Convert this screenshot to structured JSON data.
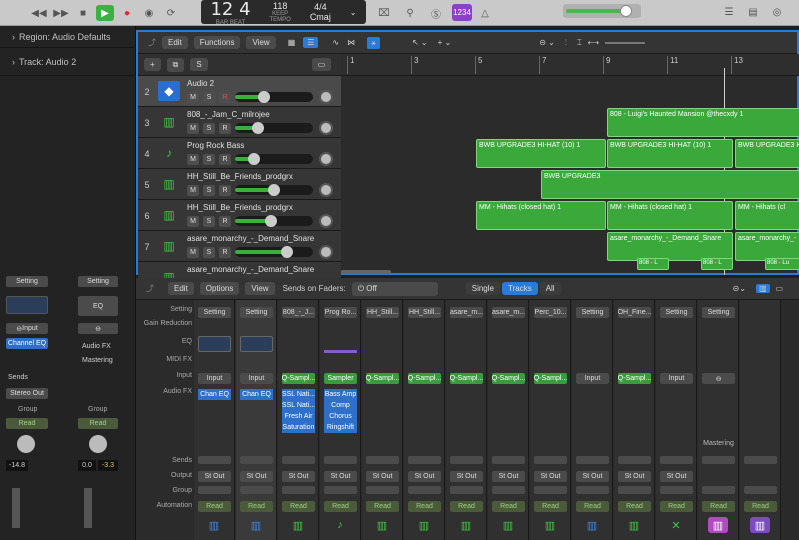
{
  "control": {
    "bar": "12",
    "beat": "4",
    "bar_lbl": "BAR",
    "beat_lbl": "BEAT",
    "tempo": "118",
    "keep": "KEEP",
    "tempo_lbl": "TEMPO",
    "sig": "4/4",
    "key": "Cmaj",
    "count_in": "1234"
  },
  "inspector": {
    "region": "Region: Audio Defaults",
    "track": "Track: Audio 2",
    "ch1": {
      "setting": "Setting",
      "input": "Input",
      "eq": "Channel EQ",
      "sends": "Sends",
      "out": "Stereo Out",
      "group": "Group",
      "read": "Read",
      "vol": "-14.8"
    },
    "ch2": {
      "setting": "Setting",
      "eq": "EQ",
      "afx": "Audio FX",
      "mast": "Mastering",
      "group": "Group",
      "read": "Read",
      "v1": "0.0",
      "v2": "-3.3"
    }
  },
  "tracks_toolbar": {
    "edit": "Edit",
    "functions": "Functions",
    "view": "View",
    "s": "S"
  },
  "ruler": [
    "1",
    "3",
    "5",
    "7",
    "9",
    "11",
    "13"
  ],
  "tracks": [
    {
      "num": "2",
      "name": "Audio 2",
      "m": "M",
      "s": "S",
      "r": "R",
      "vol": 0.35
    },
    {
      "num": "3",
      "name": "808_-_Jam_C_milrojee",
      "m": "M",
      "s": "S",
      "r": "R",
      "vol": 0.25
    },
    {
      "num": "4",
      "name": "Prog Rock Bass",
      "m": "M",
      "s": "S",
      "r": "R",
      "vol": 0.2
    },
    {
      "num": "5",
      "name": "HH_Still_Be_Friends_prodgrx",
      "m": "M",
      "s": "S",
      "r": "R",
      "vol": 0.5
    },
    {
      "num": "6",
      "name": "HH_Still_Be_Friends_prodgrx",
      "m": "M",
      "s": "S",
      "r": "R",
      "vol": 0.45
    },
    {
      "num": "7",
      "name": "asare_monarchy_-_Demand_Snare",
      "m": "M",
      "s": "S",
      "r": "R",
      "vol": 0.7
    },
    {
      "num": "",
      "name": "asare_monarchy_-_Demand_Snare",
      "m": "",
      "s": "",
      "r": "",
      "vol": 0
    }
  ],
  "regions": {
    "r808": "808 - Luigi's Haunted Mansion @thecxdy 1",
    "bwb1": "BWB UPGRADE3 HI-HAT (10) 1",
    "bwb2": "BWB UPGRADE3",
    "bwb3": "BWB UPGRADE3 HI-HAT (10) 1",
    "bwb4": "BWB UPGRADE3 HI-",
    "mm1": "MM - Hihats (closed hat) 1",
    "mm2": "MM - Hihats (closed hat) 1",
    "mm3": "MM - Hihats (cl",
    "as1": "asare_monarchy_-_Demand_Snare",
    "as2": "asare_monarchy_-",
    "l1": "808 - L",
    "l2": "808 - L",
    "l3": "808 - Lu"
  },
  "mixer": {
    "edit": "Edit",
    "options": "Options",
    "view": "View",
    "sends_on": "Sends on Faders:",
    "off": "Off",
    "single": "Single",
    "tracks": "Tracks",
    "all": "All",
    "labels": [
      "Setting",
      "Gain Reduction",
      "EQ",
      "MIDI FX",
      "Input",
      "Audio FX",
      "Sends",
      "Output",
      "Group",
      "Automation"
    ],
    "strips": [
      {
        "name": "Setting",
        "input": "Input",
        "fx": [
          "Chan EQ"
        ],
        "out": "St Out",
        "auto": "Read"
      },
      {
        "name": "Setting",
        "input": "Input",
        "fx": [
          "Chan EQ"
        ],
        "out": "St Out",
        "auto": "Read"
      },
      {
        "name": "808_-_J...",
        "input": "Q-Sampl...",
        "fx": [
          "SSL Nati...",
          "SSL Nati...",
          "Fresh Air",
          "Saturation"
        ],
        "out": "St Out",
        "auto": "Read"
      },
      {
        "name": "Prog Ro...",
        "input": "Sampler",
        "fx": [
          "Bass Amp",
          "Comp",
          "Chorus",
          "Ringshift"
        ],
        "out": "St Out",
        "auto": "Read"
      },
      {
        "name": "HH_Still...",
        "input": "Q-Sampl...",
        "fx": [],
        "out": "St Out",
        "auto": "Read"
      },
      {
        "name": "HH_Still...",
        "input": "Q-Sampl...",
        "fx": [],
        "out": "St Out",
        "auto": "Read"
      },
      {
        "name": "asare_m...",
        "input": "Q-Sampl...",
        "fx": [],
        "out": "St Out",
        "auto": "Read"
      },
      {
        "name": "asare_m...",
        "input": "Q-Sampl...",
        "fx": [],
        "out": "St Out",
        "auto": "Read"
      },
      {
        "name": "Perc_10...",
        "input": "Q-Sampl...",
        "fx": [],
        "out": "St Out",
        "auto": "Read"
      },
      {
        "name": "Setting",
        "input": "Input",
        "fx": [],
        "out": "St Out",
        "auto": "Read"
      },
      {
        "name": "OH_Fine...",
        "input": "Q-Sampl...",
        "fx": [],
        "out": "St Out",
        "auto": "Read"
      },
      {
        "name": "Setting",
        "input": "Input",
        "fx": [],
        "out": "St Out",
        "auto": "Read"
      },
      {
        "name": "Setting",
        "input": "",
        "fx": [],
        "out": "",
        "auto": "Read",
        "extra": "Mastering"
      },
      {
        "name": "",
        "input": "",
        "fx": [],
        "out": "",
        "auto": "Read"
      }
    ]
  }
}
